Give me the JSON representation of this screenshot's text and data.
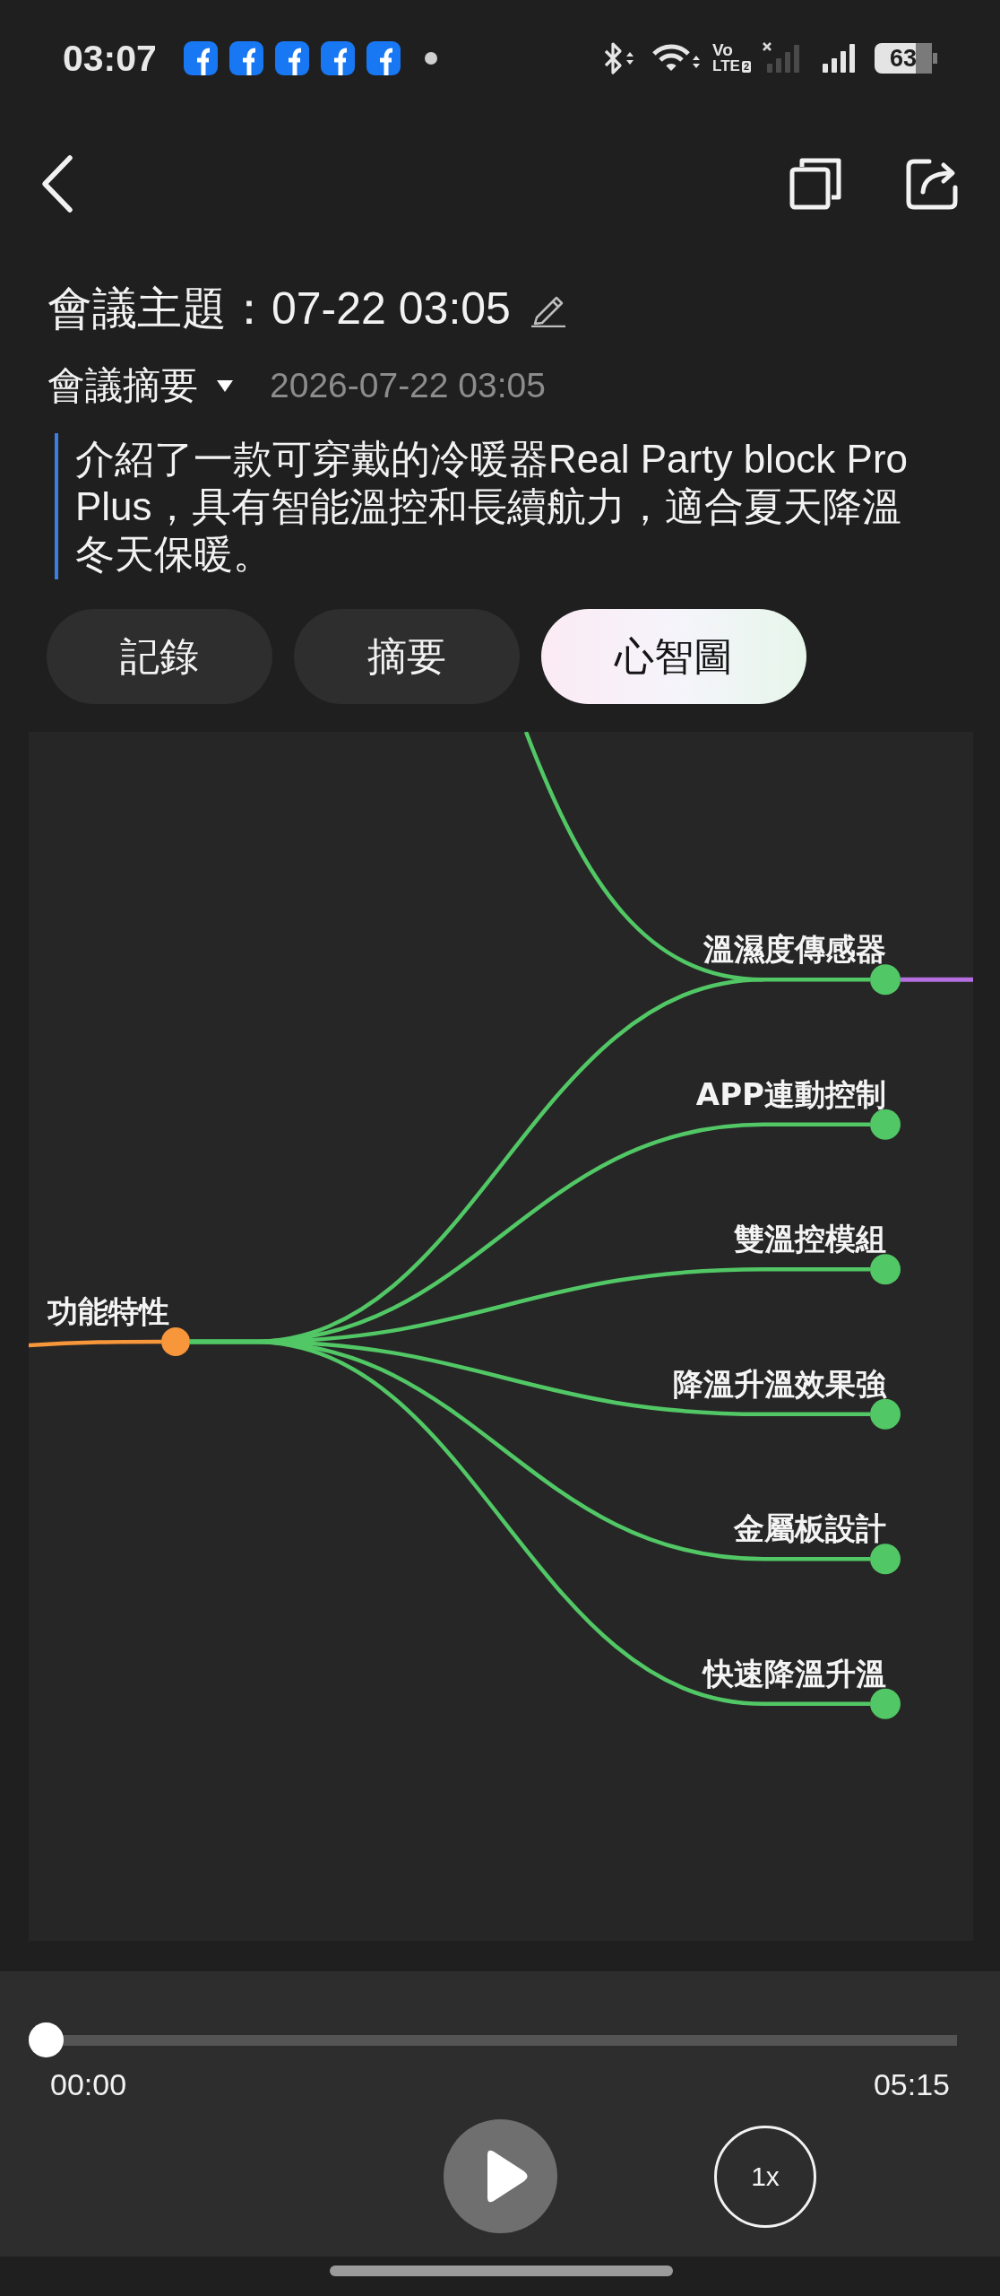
{
  "status_bar": {
    "time": "03:07",
    "network": {
      "line_1": "Vo",
      "line_2": "LTE",
      "sim": "2"
    },
    "battery": "63"
  },
  "title": "會議主題：07-22 03:05",
  "summary": {
    "label": "會議摘要",
    "expanded": true,
    "date": "2026-07-22 03:05",
    "text": "介紹了一款可穿戴的冷暖器Real Party block Pro Plus，具有智能溫控和長續航力，適合夏天降溫冬天保暖。"
  },
  "tabs": [
    {
      "label": "記錄",
      "selected": false
    },
    {
      "label": "摘要",
      "selected": false
    },
    {
      "label": "心智圖",
      "selected": true
    }
  ],
  "mind_map": {
    "branch_from_above": {
      "color": "#52c765"
    },
    "root": {
      "label": "功能特性",
      "color": "#f7963a",
      "children": [
        {
          "label": "溫濕度傳感器",
          "color": "#52c765",
          "children": [
            {
              "color": "#b46ee0"
            }
          ]
        },
        {
          "label": "APP連動控制",
          "color": "#52c765"
        },
        {
          "label": "雙溫控模組",
          "color": "#52c765"
        },
        {
          "label": "降溫升溫效果強",
          "color": "#52c765"
        },
        {
          "label": "金屬板設計",
          "color": "#52c765"
        },
        {
          "label": "快速降溫升溫",
          "color": "#52c765"
        }
      ]
    }
  },
  "player": {
    "level": 0,
    "elapsed": "00:00",
    "duration": "05:15",
    "playing": false,
    "speed": "1x"
  }
}
